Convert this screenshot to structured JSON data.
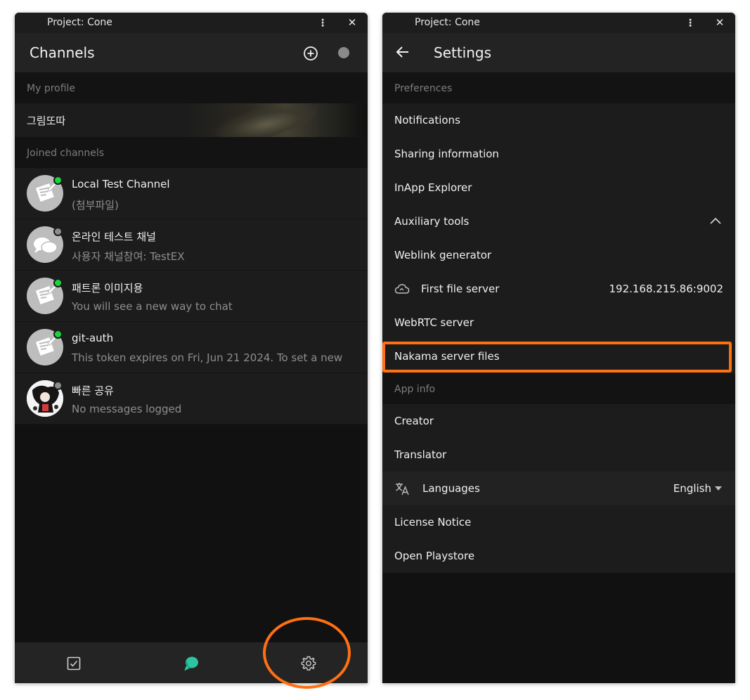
{
  "left_window": {
    "titlebar": {
      "title": "Project: Cone",
      "menu_glyph": "⋮",
      "close_glyph": "✕"
    },
    "appbar": {
      "title": "Channels",
      "add_icon": "plus-circle-icon"
    },
    "my_profile": {
      "header": "My profile",
      "name": "그림또따"
    },
    "joined_channels": {
      "header": "Joined channels",
      "items": [
        {
          "name": "Local Test Channel",
          "preview": "(첨부파일)",
          "status": "online",
          "avatar": "pencil-paper-icon"
        },
        {
          "name": "온라인 테스트 채널",
          "preview": "사용자 채널참여: TestEX",
          "status": "offline",
          "avatar": "chat-bubbles-icon"
        },
        {
          "name": "패트론 이미지용",
          "preview": "You will see a new way to chat",
          "status": "online",
          "avatar": "pencil-paper-icon"
        },
        {
          "name": "git-auth",
          "preview": "This token expires on Fri, Jun 21 2024. To set a new",
          "status": "online",
          "avatar": "pencil-paper-icon"
        },
        {
          "name": "빠른 공유",
          "preview": "No messages logged",
          "status": "offline",
          "avatar": "character-image"
        }
      ]
    },
    "bottom_nav": {
      "items": [
        "checkbox-icon",
        "chat-icon",
        "gear-icon"
      ],
      "active": "chat-icon"
    }
  },
  "right_window": {
    "titlebar": {
      "title": "Project: Cone",
      "menu_glyph": "⋮",
      "close_glyph": "✕"
    },
    "appbar": {
      "title": "Settings",
      "back_icon": "arrow-left-icon"
    },
    "preferences": {
      "header": "Preferences",
      "notifications": "Notifications",
      "sharing_information": "Sharing information",
      "inapp_explorer": "InApp Explorer",
      "auxiliary_tools": "Auxiliary tools",
      "weblink_generator": "Weblink generator",
      "first_file_server": "First file server",
      "first_file_server_value": "192.168.215.86:9002",
      "webrtc_server": "WebRTC server",
      "nakama_server_files": "Nakama server files"
    },
    "app_info": {
      "header": "App info",
      "creator": "Creator",
      "translator": "Translator",
      "languages": "Languages",
      "languages_value": "English",
      "license_notice": "License Notice",
      "open_playstore": "Open Playstore"
    }
  },
  "colors": {
    "background": "#111111",
    "panel": "#1c1c1c",
    "online": "#19d63a",
    "offline": "#8d8d8d",
    "accent_chat": "#2ec4a0",
    "highlight": "#ff7011"
  }
}
